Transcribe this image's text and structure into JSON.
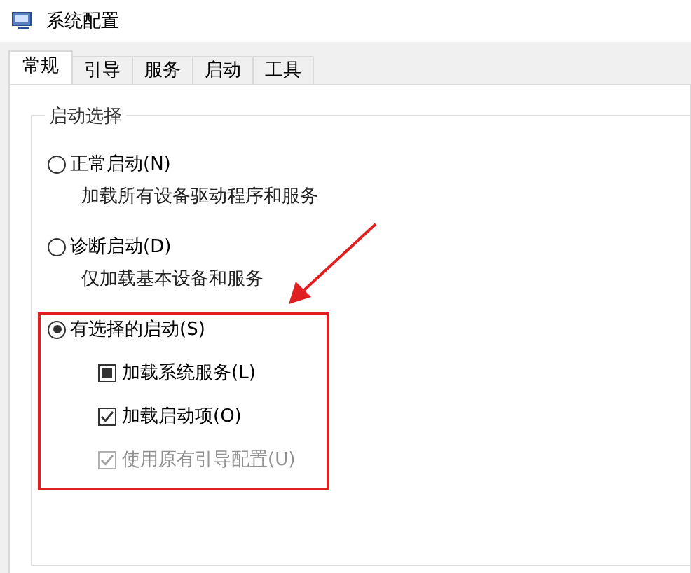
{
  "window": {
    "title": "系统配置"
  },
  "tabs": [
    {
      "label": "常规",
      "selected": true
    },
    {
      "label": "引导",
      "selected": false
    },
    {
      "label": "服务",
      "selected": false
    },
    {
      "label": "启动",
      "selected": false
    },
    {
      "label": "工具",
      "selected": false
    }
  ],
  "group": {
    "title": "启动选择",
    "options": [
      {
        "label": "正常启动(N)",
        "selected": false,
        "description": "加载所有设备驱动程序和服务"
      },
      {
        "label": "诊断启动(D)",
        "selected": false,
        "description": "仅加载基本设备和服务"
      },
      {
        "label": "有选择的启动(S)",
        "selected": true,
        "checkboxes": [
          {
            "label": "加载系统服务(L)",
            "checked": false,
            "indeterminate": true,
            "disabled": false
          },
          {
            "label": "加载启动项(O)",
            "checked": true,
            "indeterminate": false,
            "disabled": false
          },
          {
            "label": "使用原有引导配置(U)",
            "checked": true,
            "indeterminate": false,
            "disabled": true
          }
        ]
      }
    ]
  }
}
